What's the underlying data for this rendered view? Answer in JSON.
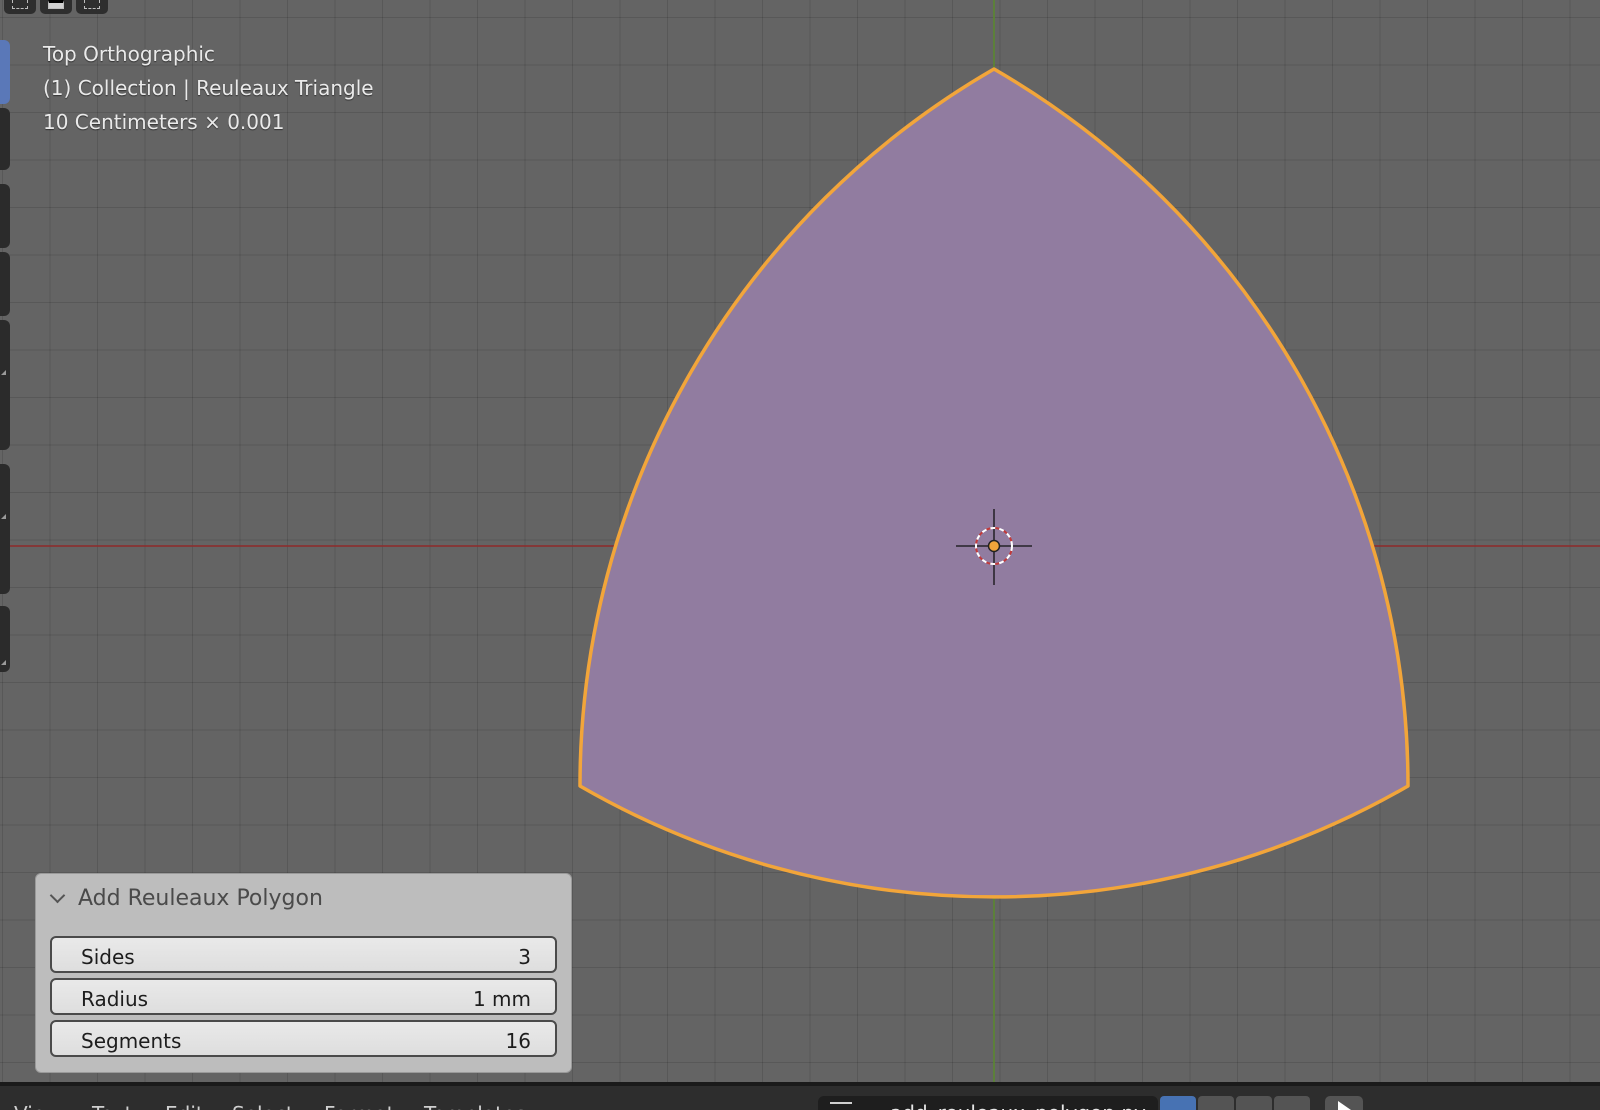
{
  "viewport": {
    "view_name": "Top Orthographic",
    "collection_line": "(1) Collection | Reuleaux Triangle",
    "scale_line": "10 Centimeters × 0.001",
    "colors": {
      "background": "#646464",
      "x_axis": "#8e2a2a",
      "y_axis": "#5a8a2c",
      "shape_fill": "#917ca0",
      "shape_outline": "#f2a53a",
      "origin_dot": "#f2a53a"
    },
    "icons": [
      "select-box-icon",
      "select-extend-icon",
      "select-subtract-icon",
      "3d-cursor-icon",
      "origin-dot-icon"
    ]
  },
  "operator_panel": {
    "title": "Add Reuleaux Polygon",
    "expanded": true,
    "fields": {
      "sides": {
        "label": "Sides",
        "value": "3"
      },
      "radius": {
        "label": "Radius",
        "value": "1 mm"
      },
      "segments": {
        "label": "Segments",
        "value": "16"
      }
    }
  },
  "text_editor_header": {
    "menu": [
      "View",
      "Text",
      "Edit",
      "Select",
      "Format",
      "Templates"
    ],
    "file_name": "add_reuleaux_polygon.py",
    "icons": [
      "text-list-icon",
      "fake-user-shield-icon",
      "new-text-icon",
      "open-folder-icon",
      "close-icon",
      "run-script-icon"
    ]
  }
}
